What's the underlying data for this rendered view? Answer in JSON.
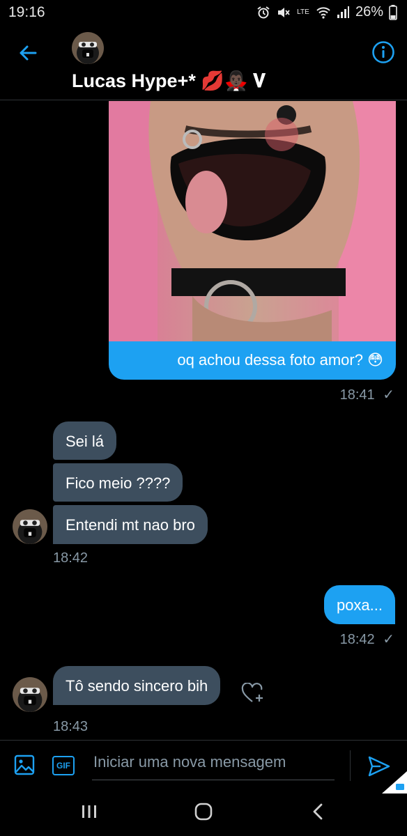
{
  "status_bar": {
    "time": "19:16",
    "network": "LTE",
    "battery": "26%"
  },
  "header": {
    "contact_name": "Lucas Hype+* 💋🧛🏿‍♂️ 𝐕"
  },
  "messages": [
    {
      "side": "out",
      "text": "oq achou dessa foto amor? 😳",
      "time": "18:41"
    },
    {
      "side": "in",
      "text": "Sei lá"
    },
    {
      "side": "in",
      "text": "Fico meio ????"
    },
    {
      "side": "in",
      "text": "Entendi mt nao bro",
      "time": "18:42"
    },
    {
      "side": "out",
      "text": "poxa...",
      "time": "18:42"
    },
    {
      "side": "in",
      "text": "Tô sendo sincero bih",
      "time": "18:43"
    }
  ],
  "composer": {
    "placeholder": "Iniciar uma nova mensagem",
    "gif_label": "GIF"
  },
  "colors": {
    "accent": "#1da1f2",
    "incoming_bubble": "#3d4e5e",
    "background": "#000000"
  }
}
